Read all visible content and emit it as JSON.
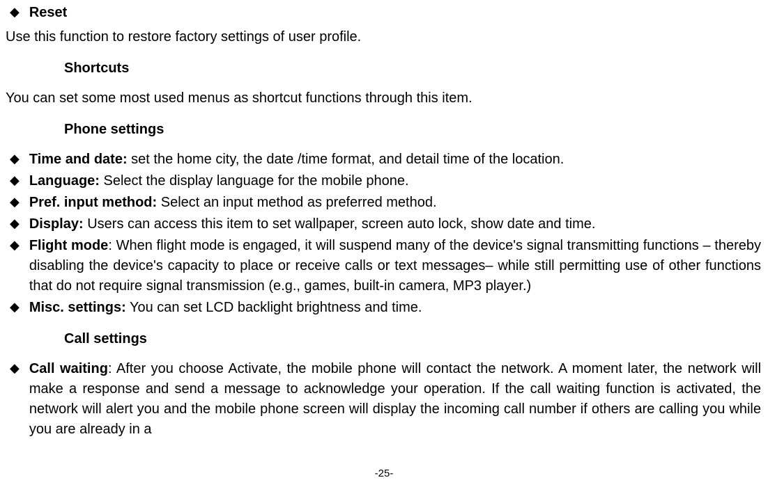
{
  "reset": {
    "title": "Reset",
    "desc": "Use this function to restore factory settings of user profile."
  },
  "shortcuts": {
    "title": "Shortcuts",
    "desc": "You can set some most used menus as shortcut functions through this item."
  },
  "phone_settings": {
    "title": "Phone settings",
    "items": [
      {
        "label": "Time and date:",
        "text": " set the home city, the date /time format, and detail time of the location."
      },
      {
        "label": "Language:",
        "text": " Select the display language for the mobile phone."
      },
      {
        "label": "Pref. input method:",
        "text": " Select an input method as preferred method."
      },
      {
        "label": "Display:",
        "text": " Users can access this item to set wallpaper, screen auto lock, show date and time."
      },
      {
        "label": "Flight mode",
        "text": ": When flight mode is engaged, it will suspend many of the device's signal transmitting functions – thereby disabling the device's capacity to place or receive calls or text messages– while still permitting use of other functions that do not require signal transmission (e.g., games, built-in camera, MP3 player.)"
      },
      {
        "label": "Misc. settings:",
        "text": " You can set LCD backlight brightness and time."
      }
    ]
  },
  "call_settings": {
    "title": "Call settings",
    "items": [
      {
        "label": "Call waiting",
        "text": ": After you choose Activate, the mobile phone will contact the network. A moment later, the network will make a response and send a message to acknowledge your operation. If the call waiting function is activated, the network will alert you and the mobile phone screen will display the incoming call number if others are calling you while you are already in a"
      }
    ]
  },
  "page_num": "-25-"
}
